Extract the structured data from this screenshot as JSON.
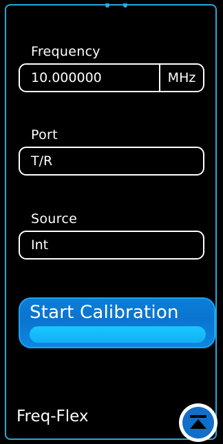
{
  "frequency": {
    "label": "Frequency",
    "value": "10.000000",
    "unit": "MHz"
  },
  "port": {
    "label": "Port",
    "value": "T/R"
  },
  "source": {
    "label": "Source",
    "value": "Int"
  },
  "start_button": {
    "label": "Start Calibration"
  },
  "footer": {
    "title": "Freq-Flex",
    "collapse_icon": "collapse-up-icon"
  },
  "colors": {
    "border": "#29a8e0",
    "button": "#0b74d0",
    "button_highlight": "#19c7ff",
    "background": "#000000",
    "text": "#ffffff"
  }
}
